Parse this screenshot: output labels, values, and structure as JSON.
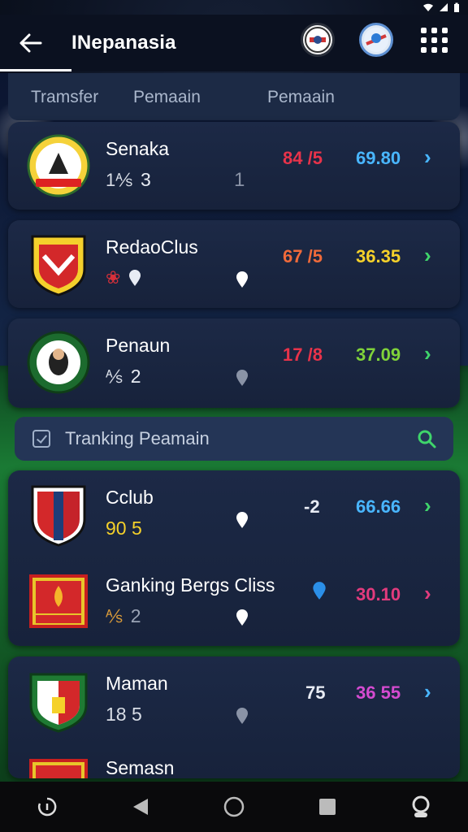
{
  "status_bar": {
    "icons": [
      "wifi-icon",
      "signal-icon",
      "battery-icon"
    ]
  },
  "header": {
    "title": "INepanasia",
    "actions": [
      "club-badge-icon",
      "league-badge-icon",
      "apps-grid-icon"
    ]
  },
  "tabs": [
    "Tramsfer",
    "Pemaain",
    "Pemaain"
  ],
  "clubs": [
    {
      "name": "Senaka",
      "sub_icon": "1⅍",
      "sub_value": "3",
      "mid_value": "1",
      "stat_a": "84 /5",
      "stat_a_color": "#e8334a",
      "stat_a2_color": "#3fb5ff",
      "stat_b": "69.80",
      "stat_b_color": "#49b6ff",
      "chevron_color": "#49b6ff"
    },
    {
      "name": "RedaoClus",
      "sub_icon": "❀",
      "sub_value": "",
      "mid_value": "",
      "stat_a": "67 /5",
      "stat_a_color": "#f06a3a",
      "stat_a2_color": "#ffc930",
      "stat_b": "36.35",
      "stat_b_color": "#f5d12a",
      "chevron_color": "#3fd56b"
    },
    {
      "name": "Penaun",
      "sub_icon": "⅍",
      "sub_value": "2",
      "mid_value": "",
      "stat_a": "17 /8",
      "stat_a_color": "#e8334a",
      "stat_a2_color": "#ffc930",
      "stat_b": "37.09",
      "stat_b_color": "#7fd23a",
      "chevron_color": "#3fd56b"
    }
  ],
  "ranking_bar": {
    "label": "Tranking Peamain"
  },
  "clubs2": [
    {
      "name": "Cclub",
      "sub_value": "90 5",
      "stat_a": "-2",
      "stat_a_color": "#49b6ff",
      "stat_b": "66.66",
      "stat_b_color": "#49b6ff",
      "chevron_color": "#3fd56b"
    },
    {
      "name": "Ganking Bergs Cliss",
      "sub_icon": "⅍",
      "sub_value": "2",
      "stat_a": "",
      "stat_b": "30.10",
      "stat_b_color": "#e23b7d",
      "chevron_color": "#e23b7d"
    },
    {
      "name": "Maman",
      "sub_value": "18 5",
      "stat_a": "75",
      "stat_a_color": "#f07a2a",
      "stat_b": "36 55",
      "stat_b_color": "#d44bd0",
      "chevron_color": "#49b6ff"
    },
    {
      "name": "Semasn"
    }
  ],
  "nav": [
    "assistant-icon",
    "back-triangle-icon",
    "home-circle-icon",
    "recents-square-icon",
    "profile-icon"
  ]
}
